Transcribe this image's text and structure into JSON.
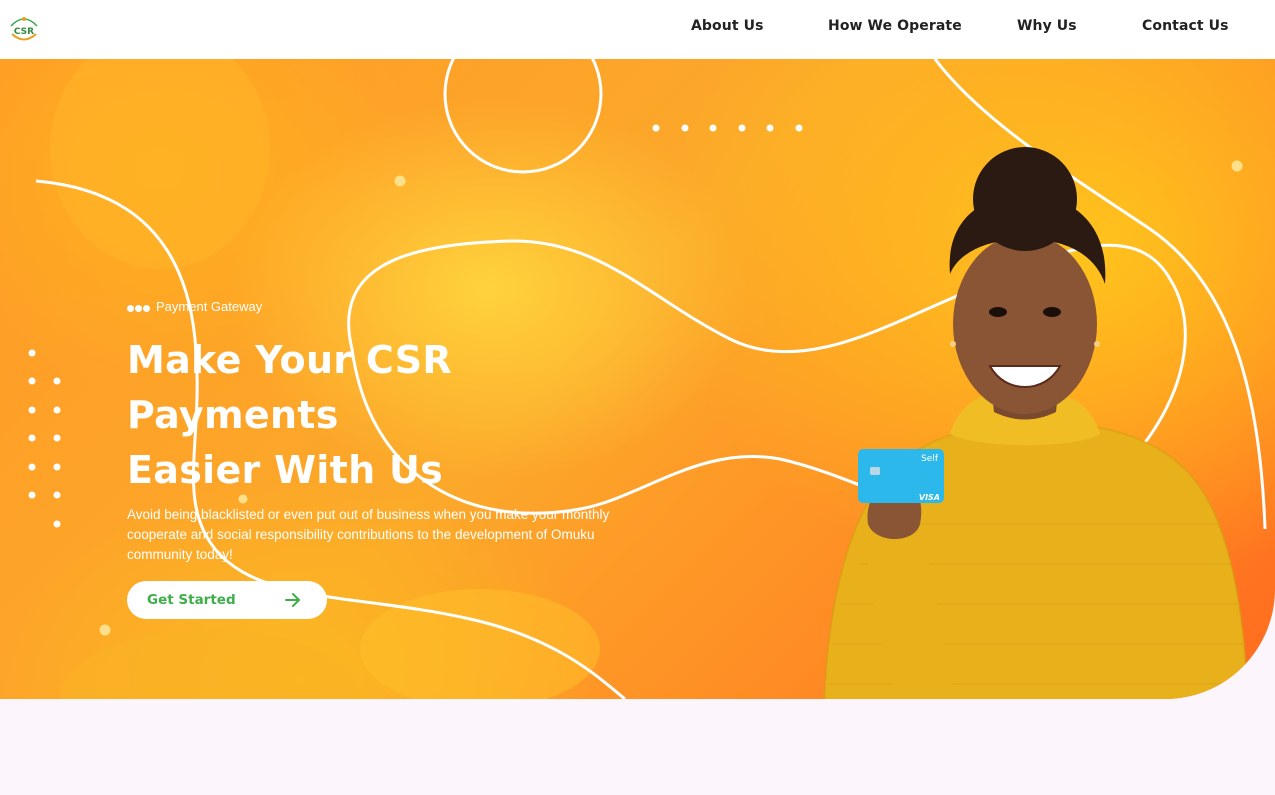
{
  "header": {
    "logo_text": "CSR",
    "nav": [
      {
        "label": "About Us"
      },
      {
        "label": "How We Operate"
      },
      {
        "label": "Why Us"
      },
      {
        "label": "Contact Us"
      }
    ]
  },
  "hero": {
    "tagline": "Payment Gateway",
    "headline_lines": [
      "Make Your CSR",
      "Payments",
      "Easier With Us"
    ],
    "description": "Avoid being blacklisted or even put out of business when you make your monthly cooperate and social responsibility contributions to the development of Omuku community today!",
    "cta_label": "Get Started",
    "cta_icon": "arrow-right-icon",
    "image": {
      "description": "smiling woman in yellow sweater holding card",
      "card_brand": "VISA",
      "card_text": "Self"
    }
  },
  "colors": {
    "hero_orange": "#fca92a",
    "hero_deep_orange": "#ff6a1e",
    "cta_green": "#3fae4a",
    "page_background": "#fcf6fc",
    "nav_text": "#222222"
  }
}
